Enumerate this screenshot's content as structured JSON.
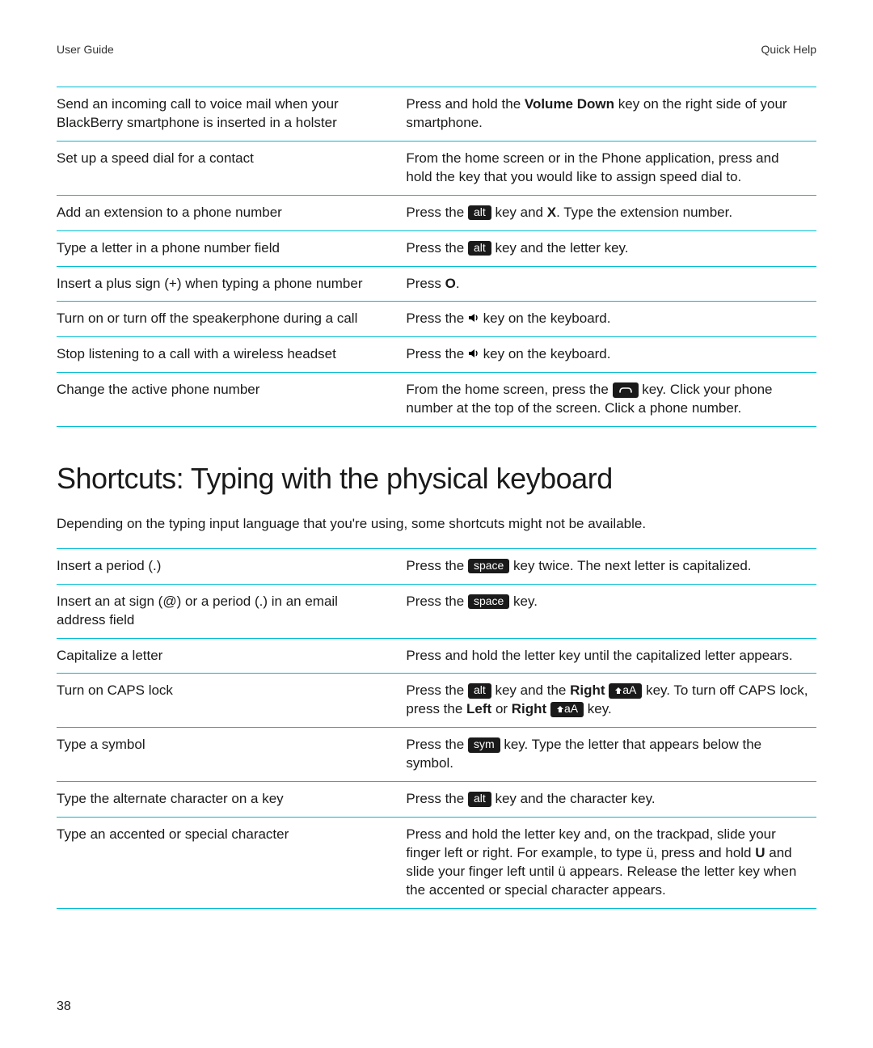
{
  "header": {
    "left": "User Guide",
    "right": "Quick Help"
  },
  "keys": {
    "alt": "alt",
    "space": "space",
    "sym": "sym",
    "shift": "aA"
  },
  "table1": {
    "rows": [
      {
        "left_parts": [
          {
            "t": "text",
            "v": "Send an incoming call to voice mail when your BlackBerry smartphone is inserted in a holster"
          }
        ],
        "right_parts": [
          {
            "t": "text",
            "v": "Press and hold the "
          },
          {
            "t": "bold",
            "v": "Volume Down"
          },
          {
            "t": "text",
            "v": " key on the right side of your smartphone."
          }
        ]
      },
      {
        "left_parts": [
          {
            "t": "text",
            "v": "Set up a speed dial for a contact"
          }
        ],
        "right_parts": [
          {
            "t": "text",
            "v": "From the home screen or in the Phone application, press and hold the key that you would like to assign speed dial to."
          }
        ]
      },
      {
        "left_parts": [
          {
            "t": "text",
            "v": "Add an extension to a phone number"
          }
        ],
        "right_parts": [
          {
            "t": "text",
            "v": "Press the "
          },
          {
            "t": "key",
            "v": "alt"
          },
          {
            "t": "text",
            "v": " key and "
          },
          {
            "t": "bold",
            "v": "X"
          },
          {
            "t": "text",
            "v": ". Type the extension number."
          }
        ]
      },
      {
        "left_parts": [
          {
            "t": "text",
            "v": "Type a letter in a phone number field"
          }
        ],
        "right_parts": [
          {
            "t": "text",
            "v": "Press the "
          },
          {
            "t": "key",
            "v": "alt"
          },
          {
            "t": "text",
            "v": " key and the letter key."
          }
        ]
      },
      {
        "left_parts": [
          {
            "t": "text",
            "v": "Insert a plus sign (+) when typing a phone number"
          }
        ],
        "right_parts": [
          {
            "t": "text",
            "v": "Press "
          },
          {
            "t": "bold",
            "v": "O"
          },
          {
            "t": "text",
            "v": "."
          }
        ]
      },
      {
        "left_parts": [
          {
            "t": "text",
            "v": "Turn on or turn off the speakerphone during a call"
          }
        ],
        "right_parts": [
          {
            "t": "text",
            "v": "Press the "
          },
          {
            "t": "icon",
            "v": "speaker"
          },
          {
            "t": "text",
            "v": " key on the keyboard."
          }
        ]
      },
      {
        "left_parts": [
          {
            "t": "text",
            "v": "Stop listening to a call with a wireless headset"
          }
        ],
        "right_parts": [
          {
            "t": "text",
            "v": "Press the "
          },
          {
            "t": "icon",
            "v": "speaker"
          },
          {
            "t": "text",
            "v": " key on the keyboard."
          }
        ]
      },
      {
        "left_parts": [
          {
            "t": "text",
            "v": "Change the active phone number"
          }
        ],
        "right_parts": [
          {
            "t": "text",
            "v": "From the home screen, press the "
          },
          {
            "t": "keyicon",
            "v": "send"
          },
          {
            "t": "text",
            "v": " key. Click your phone number at the top of the screen. Click a phone number."
          }
        ]
      }
    ]
  },
  "section2": {
    "title": "Shortcuts: Typing with the physical keyboard",
    "intro": "Depending on the typing input language that you're using, some shortcuts might not be available."
  },
  "table2": {
    "rows": [
      {
        "left_parts": [
          {
            "t": "text",
            "v": "Insert a period (.)"
          }
        ],
        "right_parts": [
          {
            "t": "text",
            "v": "Press the "
          },
          {
            "t": "key",
            "v": "space"
          },
          {
            "t": "text",
            "v": " key twice. The next letter is capitalized."
          }
        ]
      },
      {
        "left_parts": [
          {
            "t": "text",
            "v": "Insert an at sign (@) or a period (.) in an email address field"
          }
        ],
        "right_parts": [
          {
            "t": "text",
            "v": "Press the "
          },
          {
            "t": "key",
            "v": "space"
          },
          {
            "t": "text",
            "v": " key."
          }
        ]
      },
      {
        "left_parts": [
          {
            "t": "text",
            "v": "Capitalize a letter"
          }
        ],
        "right_parts": [
          {
            "t": "text",
            "v": "Press and hold the letter key until the capitalized letter appears."
          }
        ]
      },
      {
        "left_parts": [
          {
            "t": "text",
            "v": "Turn on CAPS lock"
          }
        ],
        "right_parts": [
          {
            "t": "text",
            "v": "Press the "
          },
          {
            "t": "key",
            "v": "alt"
          },
          {
            "t": "text",
            "v": " key and the "
          },
          {
            "t": "bold",
            "v": "Right"
          },
          {
            "t": "text",
            "v": " "
          },
          {
            "t": "keyshift",
            "v": "shift"
          },
          {
            "t": "text",
            "v": " key. To turn off CAPS lock, press the "
          },
          {
            "t": "bold",
            "v": "Left"
          },
          {
            "t": "text",
            "v": " or "
          },
          {
            "t": "bold",
            "v": "Right"
          },
          {
            "t": "text",
            "v": " "
          },
          {
            "t": "keyshift",
            "v": "shift"
          },
          {
            "t": "text",
            "v": " key."
          }
        ]
      },
      {
        "left_parts": [
          {
            "t": "text",
            "v": "Type a symbol"
          }
        ],
        "right_parts": [
          {
            "t": "text",
            "v": "Press the "
          },
          {
            "t": "key",
            "v": "sym"
          },
          {
            "t": "text",
            "v": " key. Type the letter that appears below the symbol."
          }
        ]
      },
      {
        "left_parts": [
          {
            "t": "text",
            "v": "Type the alternate character on a key"
          }
        ],
        "right_parts": [
          {
            "t": "text",
            "v": "Press the "
          },
          {
            "t": "key",
            "v": "alt"
          },
          {
            "t": "text",
            "v": " key and the character key."
          }
        ]
      },
      {
        "left_parts": [
          {
            "t": "text",
            "v": "Type an accented or special character"
          }
        ],
        "right_parts": [
          {
            "t": "text",
            "v": "Press and hold the letter key and, on the trackpad, slide your finger left or right. For example, to type ü, press and hold "
          },
          {
            "t": "bold",
            "v": "U"
          },
          {
            "t": "text",
            "v": " and slide your finger left until ü appears. Release the letter key when the accented or special character appears."
          }
        ]
      }
    ]
  },
  "page_number": "38"
}
